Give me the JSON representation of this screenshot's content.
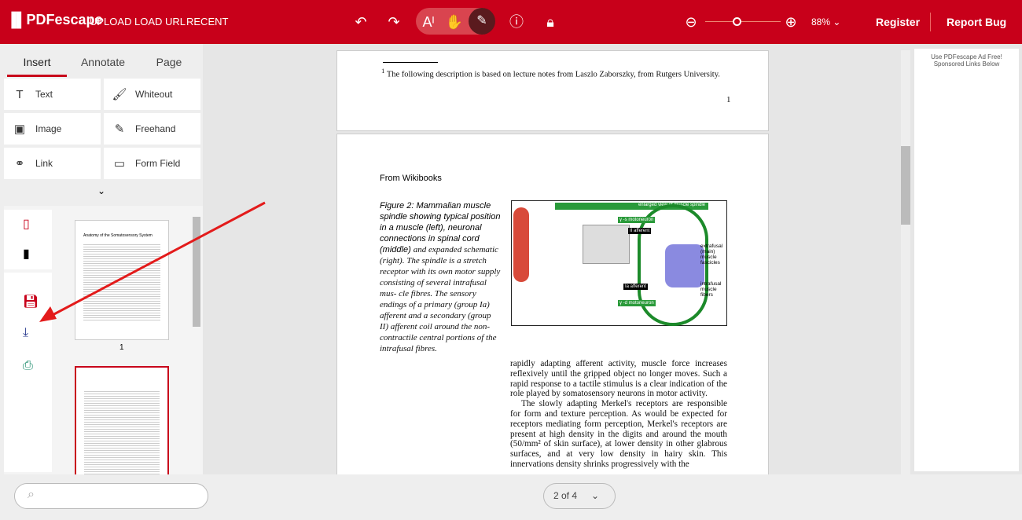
{
  "header": {
    "logo": "PDFescape",
    "nav": [
      "UPLOAD",
      "LOAD URL",
      "RECENT"
    ],
    "zoom": "88%",
    "register": "Register",
    "report_bug": "Report Bug",
    "brand_color": "#c8001a"
  },
  "left": {
    "tabs": [
      "Insert",
      "Annotate",
      "Page"
    ],
    "active_tab": "Insert",
    "tools": [
      {
        "label": "Text",
        "icon": "text-icon"
      },
      {
        "label": "Whiteout",
        "icon": "whiteout-icon"
      },
      {
        "label": "Image",
        "icon": "image-icon"
      },
      {
        "label": "Freehand",
        "icon": "freehand-icon"
      },
      {
        "label": "Link",
        "icon": "link-icon"
      },
      {
        "label": "Form Field",
        "icon": "form-field-icon"
      }
    ],
    "thumb1_title": "Anatomy of the Somatosensory System",
    "thumb1_label": "1"
  },
  "doc": {
    "footnote": "The following description is based on lecture notes from Laszlo Zaborszky, from Rutgers University.",
    "footnote_mark": "1",
    "page_number": "1",
    "source": "From Wikibooks",
    "caption_sans": "Figure 2: Mammalian muscle spindle showing typical position in a muscle (left), neuronal connections in spinal cord (middle)",
    "caption_serif": "and expanded schematic (right). The spindle is a stretch receptor with its own motor supply consisting of several intrafusal mus- cle fibres. The sensory endings of a primary (group Ia) afferent and a secondary (group II) afferent coil around the non-contractile central portions of the intrafusal fibres.",
    "figure_labels": [
      "enlarged view of muscle spindle",
      "γ -s motoneuron",
      "II afferent",
      "Ia afferent",
      "γ -d motoneuron",
      "extrafusal (main) muscle fascicles",
      "intrafusal muscle fibers"
    ],
    "body1": "rapidly adapting afferent activity, muscle force increases reflexively until the gripped object no longer moves. Such a rapid response to a tactile stimulus is a clear indication of the role played by somatosensory neurons in motor activity.",
    "body2": "The slowly adapting Merkel's receptors are responsible for form and texture perception. As would be expected for receptors mediating form perception, Merkel's receptors are present at high density in the digits and around the mouth (50/mm² of skin surface), at lower density in other glabrous surfaces, and at very low density in hairy skin. This innervations density shrinks progressively with the"
  },
  "ad": {
    "text1": "Use PDFescape Ad Free!",
    "text2": "Sponsored Links Below"
  },
  "bottom": {
    "search_placeholder": "",
    "page_indicator": "2 of 4"
  }
}
